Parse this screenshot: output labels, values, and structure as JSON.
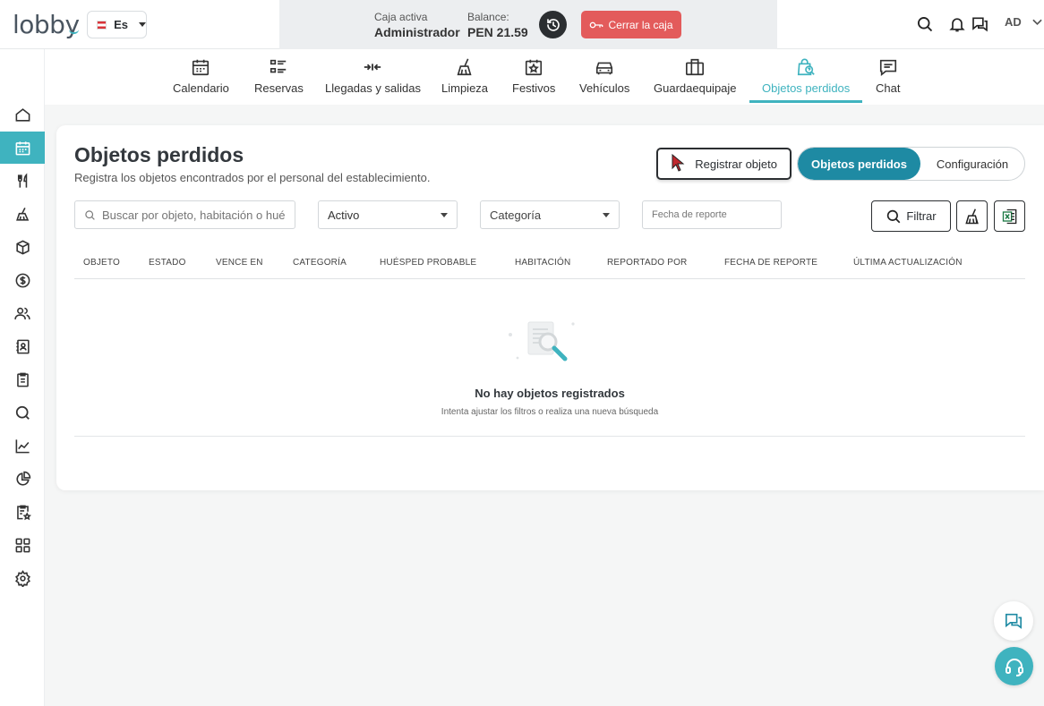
{
  "app": {
    "logo": "lobby"
  },
  "language": {
    "code": "Es"
  },
  "cash": {
    "active_label": "Caja activa",
    "active_value": "Administrador",
    "balance_label": "Balance:",
    "balance_value": "PEN 21.59",
    "close_label": "Cerrar la caja"
  },
  "user": {
    "initials": "AD"
  },
  "sidebar": {
    "items": [
      {
        "icon": "home-icon"
      },
      {
        "icon": "calendar-icon",
        "active": true
      },
      {
        "icon": "restaurant-icon"
      },
      {
        "icon": "broom-icon"
      },
      {
        "icon": "box-icon"
      },
      {
        "icon": "dollar-icon"
      },
      {
        "icon": "users-icon"
      },
      {
        "icon": "contacts-icon"
      },
      {
        "icon": "clipboard-icon"
      },
      {
        "icon": "search-icon"
      },
      {
        "icon": "line-chart-icon"
      },
      {
        "icon": "pie-chart-icon"
      },
      {
        "icon": "clipboard-star-icon"
      },
      {
        "icon": "apps-icon"
      },
      {
        "icon": "settings-icon"
      }
    ]
  },
  "modules": [
    {
      "label": "Calendario",
      "icon": "calendar-icon"
    },
    {
      "label": "Reservas",
      "icon": "list-icon"
    },
    {
      "label": "Llegadas y salidas",
      "icon": "arrows-icon"
    },
    {
      "label": "Limpieza",
      "icon": "broom-icon"
    },
    {
      "label": "Festivos",
      "icon": "calendar-star-icon"
    },
    {
      "label": "Vehículos",
      "icon": "car-icon"
    },
    {
      "label": "Guardaequipaje",
      "icon": "luggage-icon"
    },
    {
      "label": "Objetos perdidos",
      "icon": "lost-items-icon",
      "active": true
    },
    {
      "label": "Chat",
      "icon": "chat-icon"
    }
  ],
  "page": {
    "title": "Objetos perdidos",
    "subtitle": "Registra los objetos encontrados por el personal del establecimiento.",
    "register_button": "Registrar objeto",
    "tabs": [
      "Objetos perdidos",
      "Configuración"
    ]
  },
  "filters": {
    "search_placeholder": "Buscar por objeto, habitación o huésped",
    "status_value": "Activo",
    "category_value": "Categoría",
    "date_placeholder": "Fecha de reporte",
    "filter_button": "Filtrar"
  },
  "table": {
    "columns": [
      "OBJETO",
      "ESTADO",
      "VENCE EN",
      "CATEGORÍA",
      "HUÉSPED PROBABLE",
      "HABITACIÓN",
      "REPORTADO POR",
      "FECHA DE REPORTE",
      "ÚLTIMA ACTUALIZACIÓN"
    ],
    "rows": [],
    "empty_title": "No hay objetos registrados",
    "empty_subtitle": "Intenta ajustar los filtros o realiza una nueva búsqueda"
  },
  "colors": {
    "accent": "#3fb3bf",
    "primary": "#1e8aa3",
    "danger": "#e35b5b",
    "dark": "#2b2e31"
  }
}
